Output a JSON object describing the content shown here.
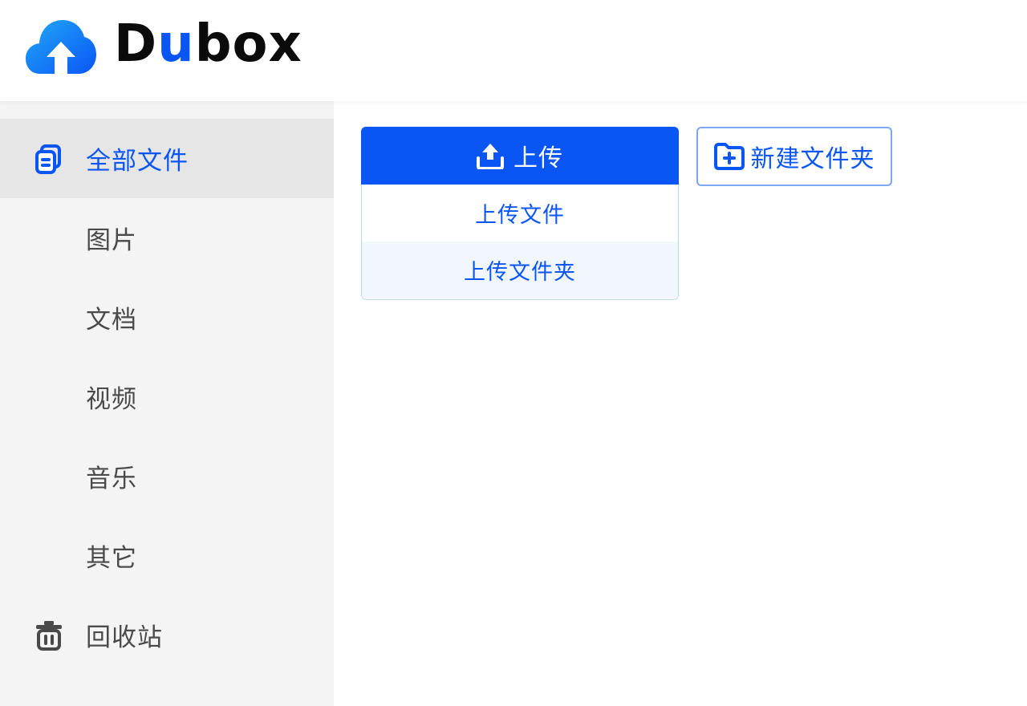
{
  "header": {
    "logo_text_d": "D",
    "logo_text_u": "u",
    "logo_text_box": "box"
  },
  "sidebar": {
    "items": [
      {
        "label": "全部文件",
        "icon": "files-icon",
        "active": true
      },
      {
        "label": "图片"
      },
      {
        "label": "文档"
      },
      {
        "label": "视频"
      },
      {
        "label": "音乐"
      },
      {
        "label": "其它"
      },
      {
        "label": "回收站",
        "icon": "trash-icon"
      }
    ]
  },
  "toolbar": {
    "upload_label": "上传",
    "upload_menu": [
      "上传文件",
      "上传文件夹"
    ],
    "new_folder_label": "新建文件夹"
  },
  "colors": {
    "accent": "#0a56f5",
    "sidebar_bg": "#f4f4f4",
    "active_bg": "#e6e6e6"
  }
}
